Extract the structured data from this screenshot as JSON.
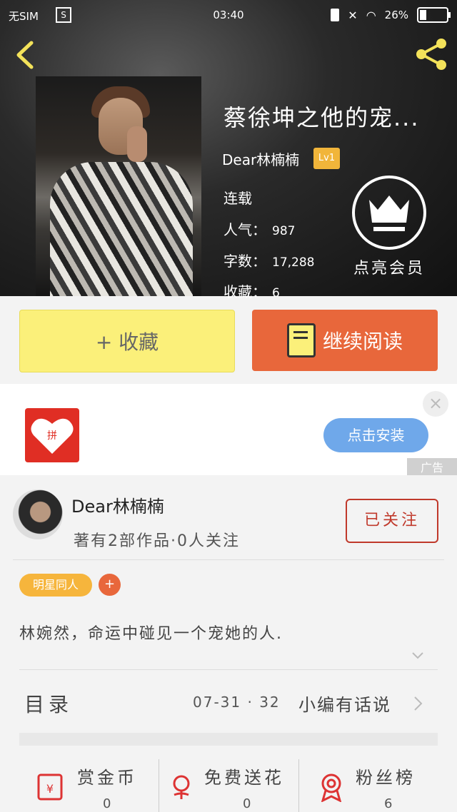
{
  "status": {
    "carrier": "无SIM",
    "time": "03:40",
    "battery": "26%"
  },
  "book": {
    "title": "蔡徐坤之他的宠...",
    "author": "Dear林楠楠",
    "level": "Lv1",
    "state": "连载",
    "popularity_label": "人气：",
    "popularity": "987",
    "words_label": "字数：",
    "words": "17,288",
    "favorites_label": "收藏：",
    "favorites": "6",
    "vip_label": "点亮会员"
  },
  "actions": {
    "favorite": "+ 收藏",
    "continue": "继续阅读"
  },
  "ad": {
    "install": "点击安装",
    "close": "×",
    "tag": "广告",
    "logo_text": "拼"
  },
  "author_card": {
    "name": "Dear林楠楠",
    "sub": "著有2部作品·0人关注",
    "follow": "已关注"
  },
  "tags": {
    "label": "明星同人",
    "add": "+"
  },
  "description": "林婉然，命运中碰见一个宠她的人.",
  "toc": {
    "label": "目录",
    "meta": "07-31 · 32",
    "tip": "小编有话说"
  },
  "bottom": [
    {
      "label": "赏金币",
      "value": "0",
      "icon": "red-envelope-icon"
    },
    {
      "label": "免费送花",
      "value": "0",
      "icon": "flower-icon"
    },
    {
      "label": "粉丝榜",
      "value": "6",
      "icon": "medal-icon"
    }
  ],
  "colors": {
    "accent": "#e8673b",
    "yellow": "#fbf07a",
    "follow": "#c0392b",
    "tag": "#f6b53c"
  }
}
